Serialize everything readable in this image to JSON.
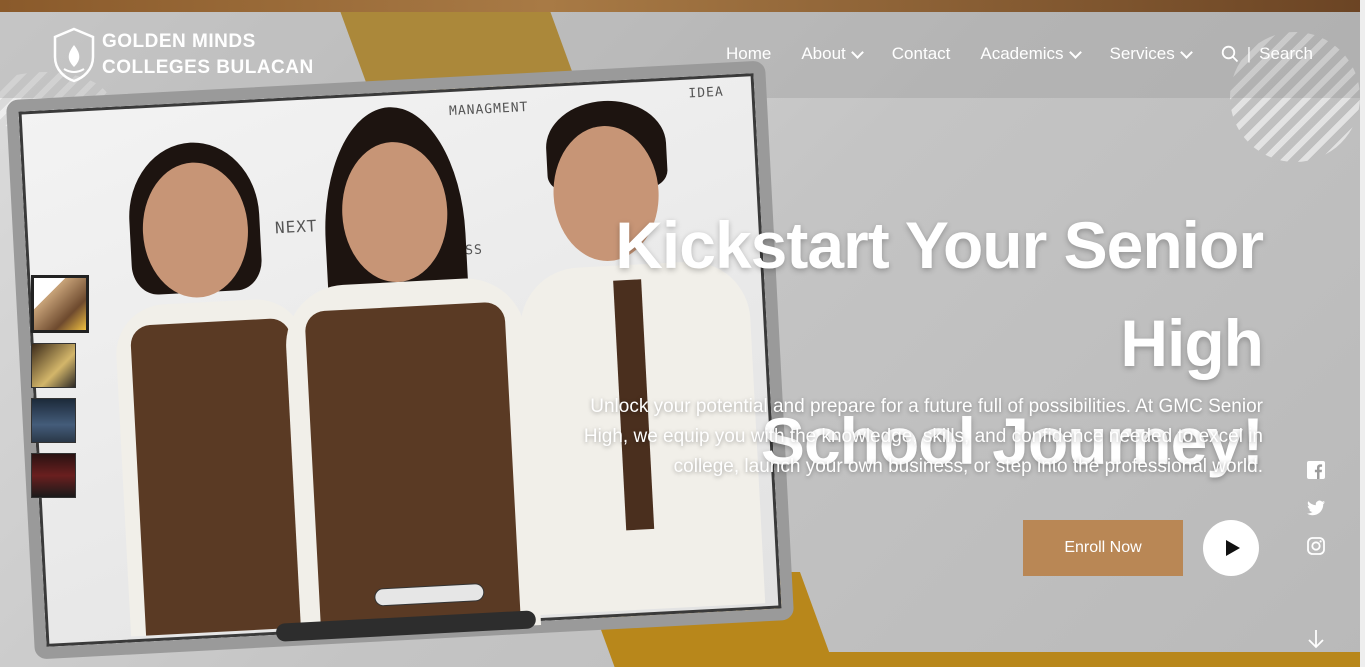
{
  "brand": {
    "line1": "GOLDEN MINDS",
    "line2": "COLLEGES BULACAN"
  },
  "nav": {
    "items": [
      {
        "label": "Home",
        "dropdown": false
      },
      {
        "label": "About",
        "dropdown": true
      },
      {
        "label": "Contact",
        "dropdown": false
      },
      {
        "label": "Academics",
        "dropdown": true
      },
      {
        "label": "Services",
        "dropdown": true
      }
    ],
    "search_separator": "|",
    "search_label": "Search"
  },
  "hero": {
    "headline_line1": "Kickstart Your Senior High",
    "headline_line2": "School Journey!",
    "subtext_line1": "Unlock your potential and prepare for a future full of possibilities. At GMC Senior",
    "subtext_line2": "High, we equip you with the knowledge, skills, and confidence needed to excel in",
    "subtext_line3": "college, launch your own business, or step into the professional world.",
    "enroll_label": "Enroll Now"
  },
  "board_sketch": {
    "word1": "MANAGMENT",
    "word2": "NEXT",
    "word3": "IDEA",
    "word4": "ESS"
  },
  "thumbnails": {
    "count": 4,
    "active_index": 0
  },
  "social": [
    "facebook-icon",
    "twitter-icon",
    "instagram-icon"
  ],
  "colors": {
    "accent_gold": "#b8871b",
    "enroll_bg": "#b98755",
    "top_bar": "#8a5a2b",
    "text_light": "#ffffff"
  }
}
